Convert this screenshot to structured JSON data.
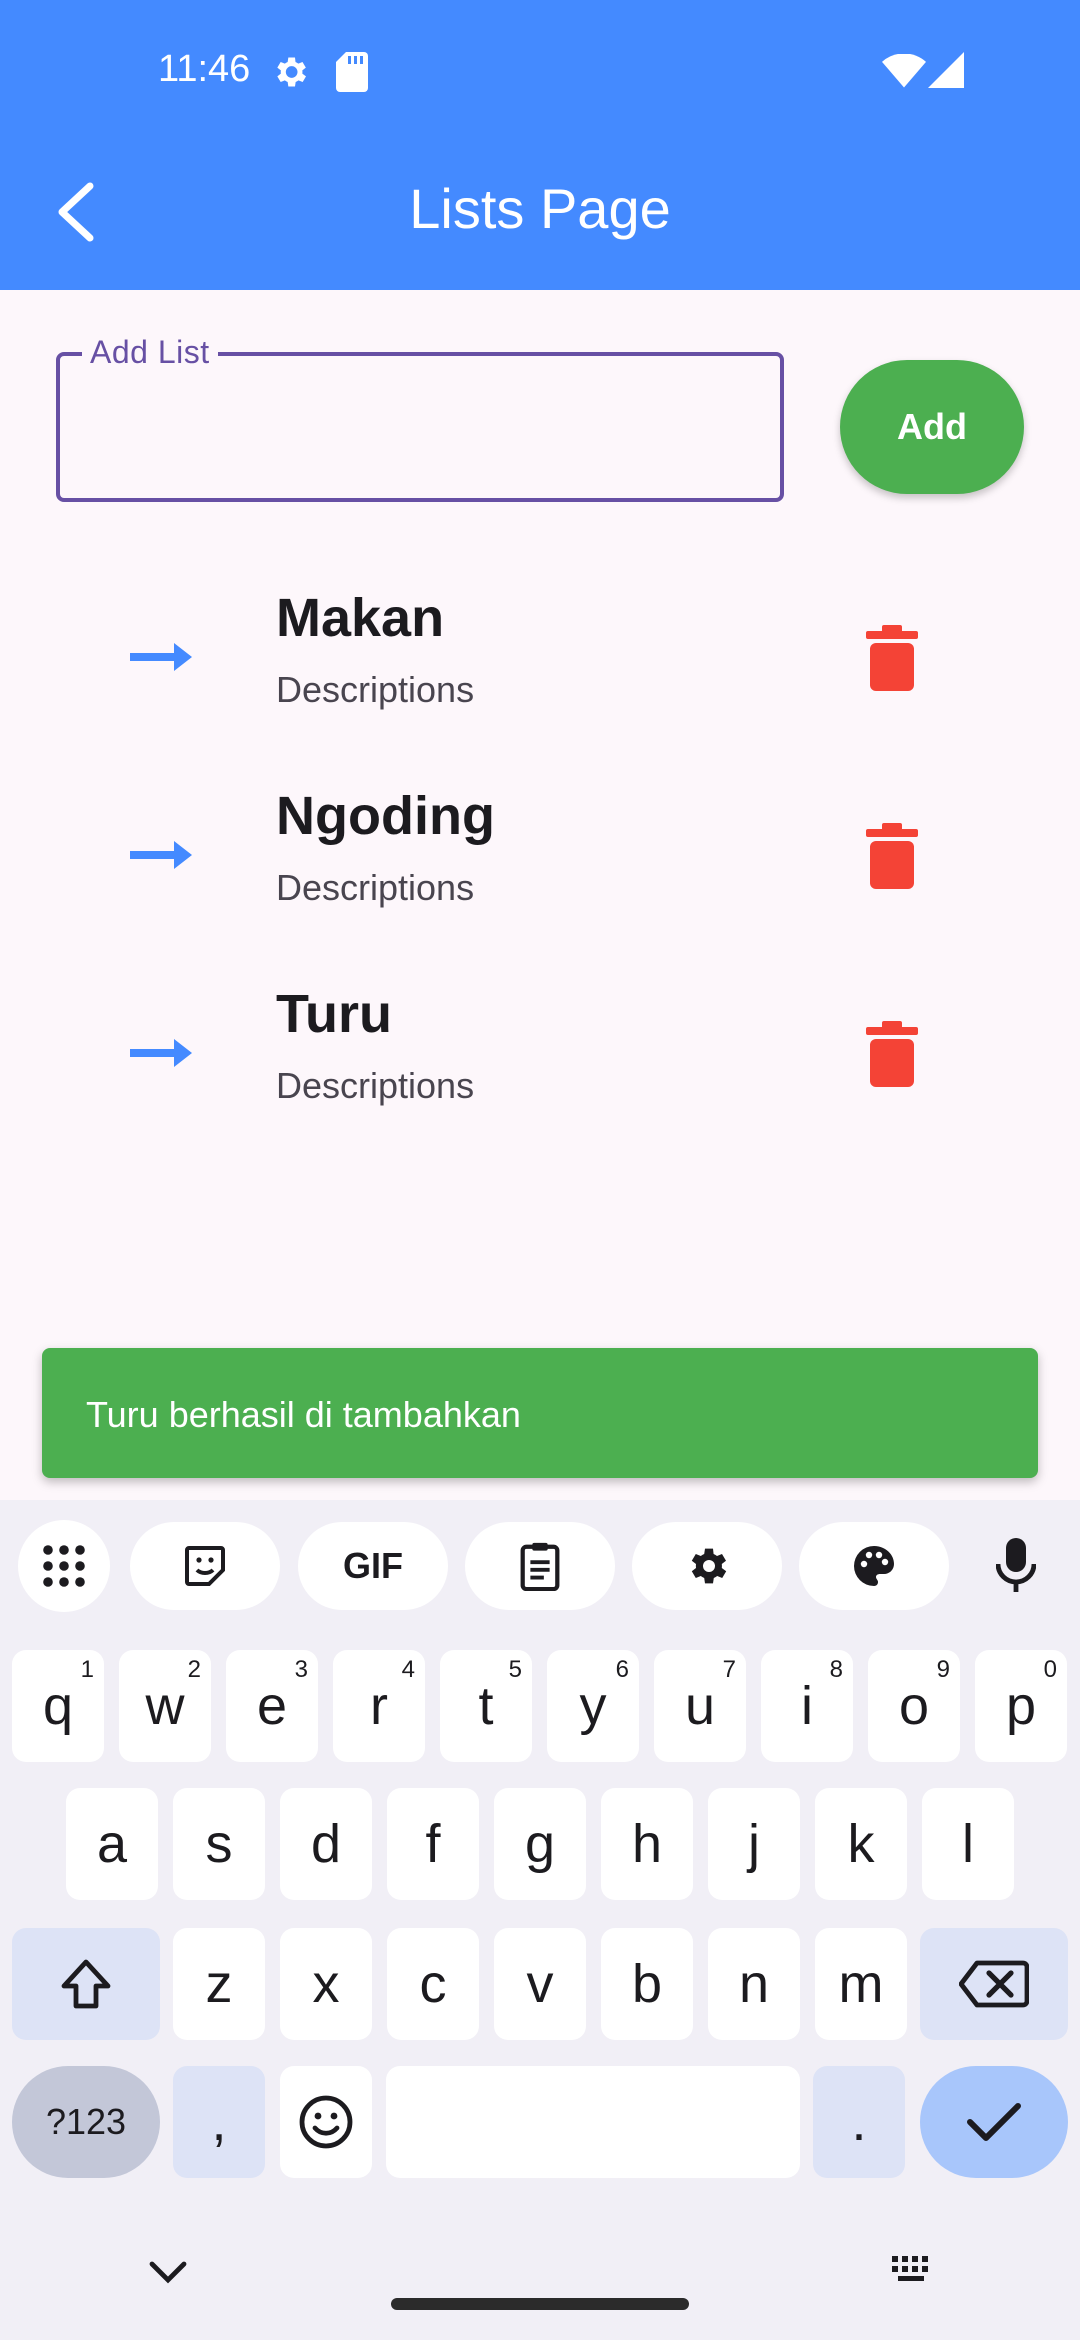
{
  "status_bar": {
    "time": "11:46"
  },
  "app_bar": {
    "title": "Lists Page"
  },
  "form": {
    "label": "Add List",
    "value": "",
    "add_label": "Add"
  },
  "list": [
    {
      "title": "Makan",
      "desc": "Descriptions"
    },
    {
      "title": "Ngoding",
      "desc": "Descriptions"
    },
    {
      "title": "Turu",
      "desc": "Descriptions"
    }
  ],
  "snackbar": {
    "message": "Turu berhasil di tambahkan"
  },
  "keyboard": {
    "row1": [
      {
        "k": "q",
        "n": "1"
      },
      {
        "k": "w",
        "n": "2"
      },
      {
        "k": "e",
        "n": "3"
      },
      {
        "k": "r",
        "n": "4"
      },
      {
        "k": "t",
        "n": "5"
      },
      {
        "k": "y",
        "n": "6"
      },
      {
        "k": "u",
        "n": "7"
      },
      {
        "k": "i",
        "n": "8"
      },
      {
        "k": "o",
        "n": "9"
      },
      {
        "k": "p",
        "n": "0"
      }
    ],
    "row2": [
      "a",
      "s",
      "d",
      "f",
      "g",
      "h",
      "j",
      "k",
      "l"
    ],
    "row3": [
      "z",
      "x",
      "c",
      "v",
      "b",
      "n",
      "m"
    ],
    "sym_label": "?123",
    "comma": ",",
    "period": ".",
    "gif_label": "GIF"
  },
  "colors": {
    "primary": "#448aff",
    "success": "#4caf50",
    "danger": "#f44336",
    "outline": "#6750a4"
  }
}
